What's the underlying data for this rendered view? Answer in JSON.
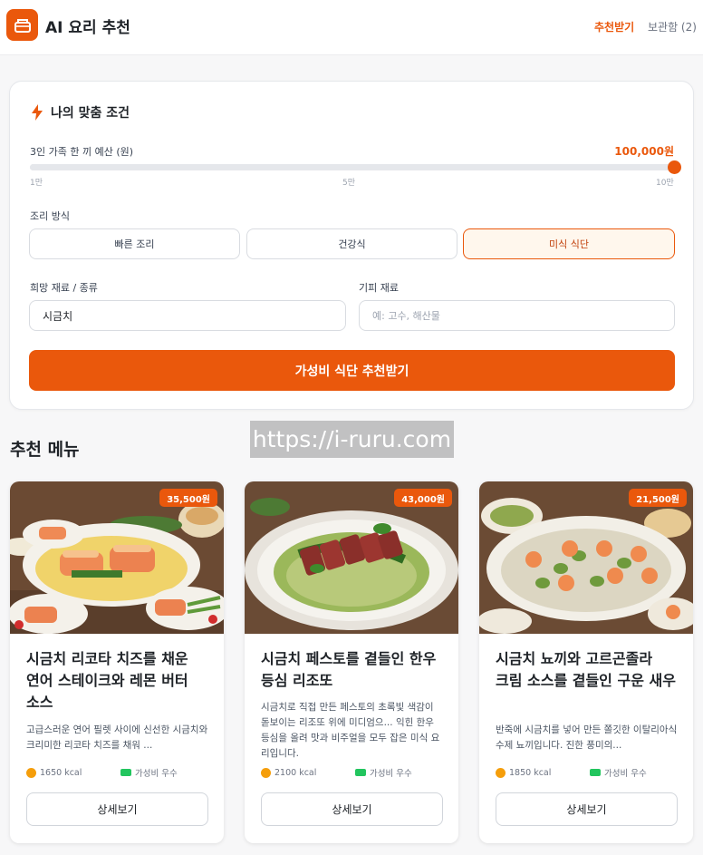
{
  "header": {
    "title": "AI 요리 추천",
    "nav_recommend": "추천받기",
    "nav_saved": "보관함 (2)"
  },
  "conditions": {
    "title": "나의 맞춤 조건",
    "budget_label": "3인 가족 한 끼 예산 (원)",
    "budget_value": "100,000원",
    "budget_fraction": 1.0,
    "ticks": [
      "1만",
      "5만",
      "10만"
    ],
    "cook_label": "조리 방식",
    "cook_options": [
      "빠른 조리",
      "건강식",
      "미식 식단"
    ],
    "cook_selected": "미식 식단",
    "want_label": "희망 재료 / 종류",
    "want_value": "시금치",
    "avoid_label": "기피 재료",
    "avoid_placeholder": "예: 고수, 해산물",
    "submit": "가성비 식단 추천받기"
  },
  "watermark": "https://i-ruru.com",
  "section_title": "추천 메뉴",
  "menus": [
    {
      "price": "35,500원",
      "title": "시금치 리코타 치즈를 채운 연어 스테이크와 레몬 버터 소스",
      "desc": "고급스러운 연어 필렛 사이에 신선한 시금치와 크리미한 리코타 치즈를 채워 ...",
      "kcal": "1650 kcal",
      "value": "가성비 우수",
      "detail": "상세보기"
    },
    {
      "price": "43,000원",
      "title": "시금치 페스토를 곁들인 한우 등심 리조또",
      "desc": "시금치로 직접 만든 페스토의 초록빛 색감이 돋보이는 리조또 위에 미디엄으... 익힌 한우 등심을 올려 맛과 비주얼을 모두 잡은 미식 요리입니다.",
      "kcal": "2100 kcal",
      "value": "가성비 우수",
      "detail": "상세보기"
    },
    {
      "price": "21,500원",
      "title": "시금치 뇨끼와 고르곤졸라 크림 소스를 곁들인 구운 새우",
      "desc": "반죽에 시금치를 넣어 만든 쫄깃한 이탈리아식 수제 뇨끼입니다. 진한 풍미의...",
      "kcal": "1850 kcal",
      "value": "가성비 우수",
      "detail": "상세보기"
    }
  ]
}
